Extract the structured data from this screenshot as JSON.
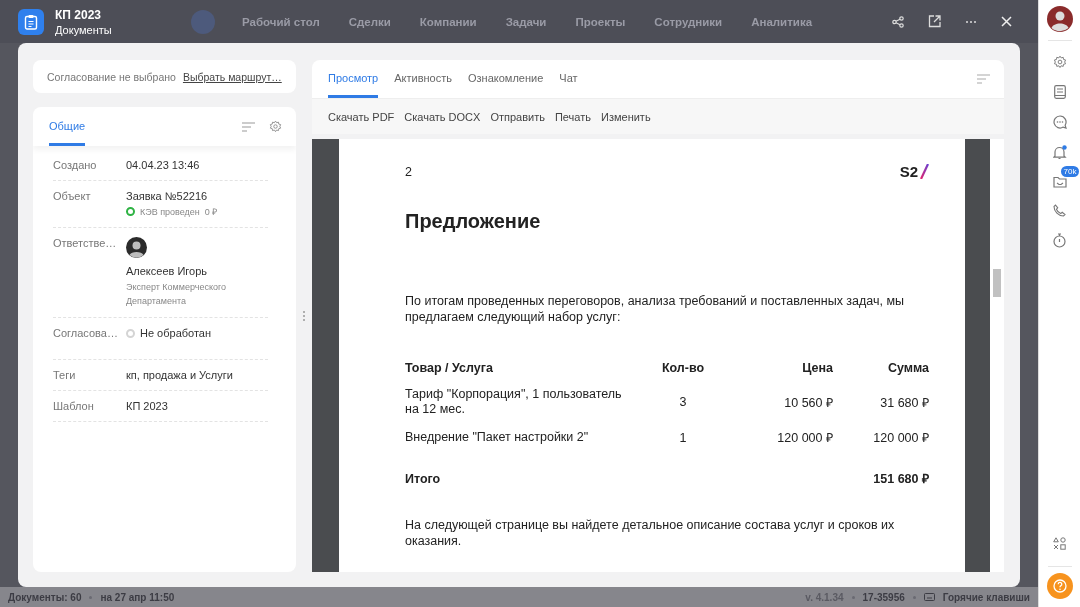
{
  "background_nav": {
    "items": [
      "Рабочий стол",
      "Сделки",
      "Компании",
      "Задачи",
      "Проекты",
      "Сотрудники",
      "Аналитика"
    ]
  },
  "window": {
    "title": "КП 2023",
    "subtitle": "Документы"
  },
  "approval": {
    "status": "Согласование не выбрано",
    "link": "Выбрать маршрут…"
  },
  "info_panel": {
    "tabs": [
      {
        "label": "Общие",
        "selected": true
      }
    ],
    "fields": [
      {
        "kind": "text",
        "label": "Создано",
        "value": "04.04.23 13:46"
      },
      {
        "kind": "object",
        "label": "Объект",
        "value": "Заявка №52216",
        "status": {
          "label": "КЭВ проведен",
          "color": "#2fb344"
        },
        "amount": "0 ₽"
      },
      {
        "kind": "person",
        "label": "Ответстве…",
        "name": "Алексеев Игорь",
        "position": "Эксперт Коммерческого Департамента"
      },
      {
        "kind": "status",
        "label": "Согласова…",
        "value": "Не обработан",
        "color": "#d4d4d4"
      },
      {
        "kind": "text",
        "label": "Теги",
        "value": "кп, продажа и Услуги"
      },
      {
        "kind": "text",
        "label": "Шаблон",
        "value": "КП 2023"
      }
    ]
  },
  "viewer": {
    "tabs": [
      {
        "label": "Просмотр",
        "selected": true
      },
      {
        "label": "Активность",
        "selected": false
      },
      {
        "label": "Ознакомление",
        "selected": false
      },
      {
        "label": "Чат",
        "selected": false
      }
    ],
    "actions": [
      "Скачать PDF",
      "Скачать DOCX",
      "Отправить",
      "Печать",
      "Изменить"
    ],
    "document": {
      "page_number": "2",
      "logo": "S2",
      "heading": "Предложение",
      "intro": "По итогам проведенных переговоров, анализа требований и поставленных задач, мы предлагаем следующий набор услуг:",
      "table": {
        "columns": [
          "Товар / Услуга",
          "Кол-во",
          "Цена",
          "Сумма"
        ],
        "rows": [
          [
            "Тариф \"Корпорация\", 1 пользователь на 12 мес.",
            "3",
            "10 560 ₽",
            "31 680 ₽"
          ],
          [
            "Внедрение \"Пакет настройки 2\"",
            "1",
            "120 000 ₽",
            "120 000 ₽"
          ]
        ],
        "total": {
          "label": "Итого",
          "value": "151 680 ₽"
        }
      },
      "outro": "На следующей странице вы найдете детальное описание состава услуг и сроков их оказания."
    }
  },
  "sidebar": {
    "bell_unread": true,
    "inbox_badge": "70k"
  },
  "status_bar": {
    "documents": "Документы: 60",
    "updated": "на 27 апр 11:50",
    "version": "v. 4.1.34",
    "build": "17-35956",
    "hotkeys": "Горячие клавиши"
  }
}
